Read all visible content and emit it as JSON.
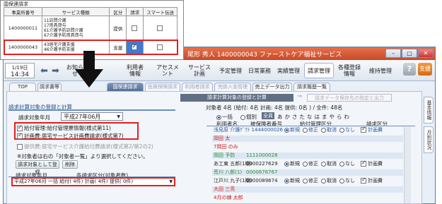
{
  "zoom": {
    "title": "国保連請求",
    "headers": [
      "事業所番号",
      "サービス種類",
      "区分",
      "請求",
      "スマート伝送"
    ],
    "rows": [
      {
        "number": "1400000011",
        "services": [
          "11訪問介護",
          "17用具貸与",
          "61介護予防訪問介護",
          "67介護予防用具貸与"
        ],
        "kubun": "提供",
        "seikyu": false,
        "smart": false
      },
      {
        "number": "1400000043",
        "services": [
          "43居宅介護支援",
          "46介護予防支援"
        ],
        "kubun": "支援",
        "seikyu": true,
        "smart": false
      }
    ]
  },
  "window": {
    "title": "尾形 秀人 1400000043 ファーストケア福祉サービス",
    "clock": {
      "date": "1/19日",
      "time": "14:34"
    }
  },
  "menu": {
    "items": [
      "お知らせ",
      "利用者情報",
      "アセスメント",
      "サービス計画",
      "予定管理",
      "日常業務",
      "実績管理",
      "請求管理",
      "各種登録情報",
      "維持管理"
    ],
    "help": "?",
    "support": "支援"
  },
  "tabs": [
    "TOP",
    "請求書等",
    "国保連請求",
    "医療保険請求",
    "利用者請求",
    "売掛入金管理",
    "売上データ出力",
    "請求履歴一覧"
  ],
  "left": {
    "header": "請求計算対象の登録と計算",
    "target_month_label": "請求対象年月",
    "target_month": "平成27年06月",
    "check1": "給付管理:給付管理票情報(様式第11)",
    "check2": "計画費:居宅サービス計画費請求(様式第7)",
    "check3": "提供費:居宅サービス介護給付費請求(様式第2/第2の2)",
    "note": "※対象者は右の「対象者一覧」より選択してください。",
    "register_button": "請求対象として登録",
    "delete_button": "削除",
    "list_col1": "請求対象年月",
    "list_col2": "各請求区分(対象者数)",
    "selected_row": "平成27年06月 一括 給付( 4件) 計画( 4件) 提供( 0件)"
  },
  "center": {
    "header": "請求計算対象の登録と計算",
    "arrow": "⇒",
    "next_step": "請求データ保存先の指定と出力"
  },
  "right": {
    "summary": "対象者 4名 (給付: 4名 計画: 4名 提供: 0名 ) / 全件: 48名",
    "radio_all": "一括",
    "radio_indiv": "個別",
    "kana_all": "全員",
    "kana": "あかさたなはまやらわ",
    "col_name": "利用者名",
    "col_number": "被保険者番号",
    "col_kyufu": "給付管理区分",
    "col_kubun": "請求区分",
    "rows": [
      {
        "name": "浅見原 介護ｹﾞﾜﾃ 1444000026",
        "number": "",
        "kyufu": "新規",
        "plan": true,
        "style": "blue"
      },
      {
        "name": "岡田 太",
        "number": "",
        "kyufu": "",
        "plan": false,
        "style": "red"
      },
      {
        "name": "7岡田 のみ",
        "number": "",
        "kyufu": "",
        "plan": false,
        "style": "red"
      },
      {
        "name": "岡田 予防",
        "number": "1111000028",
        "kyufu": "",
        "plan": false,
        "style": "green"
      },
      {
        "name": "あ工東 五郎(1期)",
        "number": "0000227629",
        "kyufu": "新規",
        "plan": true,
        "style": ""
      },
      {
        "name": "荒川 八郎(1)",
        "number": "0000676767",
        "kyufu": "",
        "plan": false,
        "style": "green"
      },
      {
        "name": "江戸川 九子(1期)",
        "number": "0000089674",
        "kyufu": "新規",
        "plan": true,
        "style": ""
      },
      {
        "name": "大田 三亮",
        "number": "",
        "kyufu": "",
        "plan": false,
        "style": "red"
      },
      {
        "name": "4月の練 太郎",
        "number": "",
        "kyufu": "",
        "plan": false,
        "style": "red"
      }
    ],
    "options": [
      "新規",
      "修正",
      "取消",
      "なし"
    ],
    "plan_label": "計画費"
  },
  "side": {
    "tab1": "基本情報",
    "tab2": "月別状況"
  },
  "colors": {
    "accent": "#e02020",
    "title_bar": "#c74a2a",
    "menu": "#dfe6ef"
  }
}
